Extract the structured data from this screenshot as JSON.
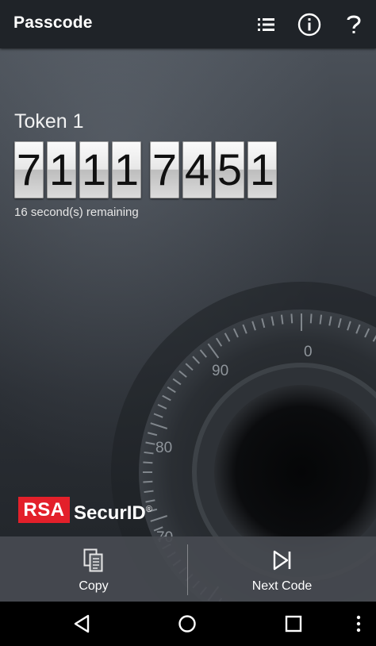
{
  "appbar": {
    "title": "Passcode",
    "icons": [
      "list-icon",
      "info-icon",
      "help-icon"
    ]
  },
  "token": {
    "name": "Token 1",
    "digits": [
      "7",
      "1",
      "1",
      "1",
      "7",
      "4",
      "5",
      "1"
    ],
    "remaining": "16 second(s) remaining"
  },
  "dial": {
    "labels": [
      "0",
      "90",
      "80",
      "70"
    ]
  },
  "brand": {
    "rsa": "RSA",
    "securid": "SecurID",
    "trademark": "®",
    "rsa_color": "#e3202a"
  },
  "actions": {
    "copy_label": "Copy",
    "next_label": "Next Code"
  },
  "navbar": {
    "icons": [
      "back-icon",
      "home-icon",
      "recents-icon",
      "overflow-menu-icon"
    ]
  }
}
